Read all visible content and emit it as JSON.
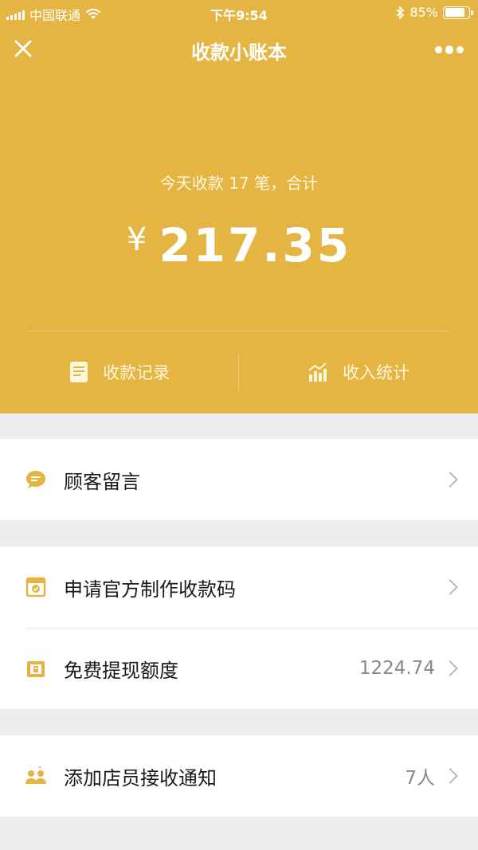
{
  "status_bar": {
    "carrier": "中国联通",
    "time": "下午9:54",
    "battery": "85%",
    "battery_level": 0.85
  },
  "navbar": {
    "title": "收款小账本",
    "close_icon": "close-icon",
    "more_icon": "more-icon"
  },
  "summary": {
    "today_text": "今天收款 17 笔，合计",
    "currency": "¥",
    "amount": "217.35"
  },
  "actions": [
    {
      "label": "收款记录",
      "icon": "receipt-icon"
    },
    {
      "label": "收入统计",
      "icon": "chart-icon"
    }
  ],
  "list": {
    "customer_message": {
      "label": "顾客留言",
      "icon": "chat-bubble-icon"
    },
    "apply_code": {
      "label": "申请官方制作收款码",
      "icon": "qr-card-icon"
    },
    "free_withdraw": {
      "label": "免费提现额度",
      "value": "1224.74",
      "icon": "withdraw-icon"
    },
    "staff_notify": {
      "label": "添加店员接收通知",
      "value": "7人",
      "icon": "staff-icon"
    }
  },
  "colors": {
    "accent": "#e5b543",
    "background": "#ededed"
  }
}
